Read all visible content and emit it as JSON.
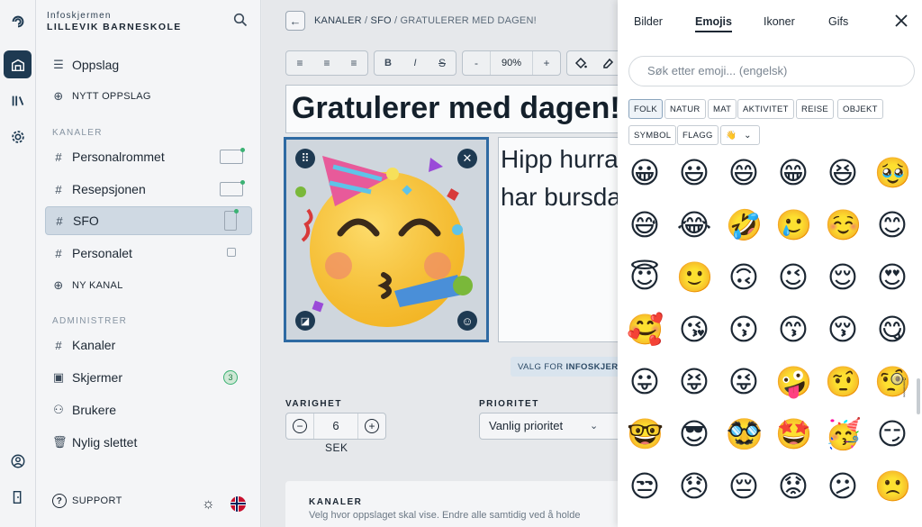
{
  "sidebar": {
    "brand_top": "Infoskjermen",
    "brand_name": "LILLEVIK BARNESKOLE",
    "oppslag": "Oppslag",
    "nytt_oppslag": "NYTT OPPSLAG",
    "kanaler_heading": "KANALER",
    "channels": [
      "Personalrommet",
      "Resepsjonen",
      "SFO",
      "Personalet"
    ],
    "ny_kanal": "NY KANAL",
    "administrer_heading": "ADMINISTRER",
    "admin": [
      "Kanaler",
      "Skjermer",
      "Brukere",
      "Nylig slettet"
    ],
    "skjermer_count": "3",
    "support": "SUPPORT"
  },
  "editor": {
    "crumb_1": "KANALER",
    "crumb_sep": " / ",
    "crumb_2": "SFO",
    "crumb_3": "GRATULERER MED DAGEN!",
    "zoom": "90%",
    "title": "Gratulerer med dagen!",
    "body_line_1": "Hipp hurra!",
    "body_line_2": "har bursdag!",
    "valg_prefix": "VALG FOR",
    "valg_target": "INFOSKJERMEN",
    "varighet_label": "VARIGHET",
    "varighet_value": "6",
    "varighet_unit": "SEK",
    "prioritet_label": "PRIORITET",
    "prioritet_value": "Vanlig prioritet",
    "kanaler_title": "KANALER",
    "kanaler_desc": "Velg hvor oppslaget skal vise. Endre alle samtidig ved å holde"
  },
  "picker": {
    "tabs": [
      "Bilder",
      "Emojis",
      "Ikoner",
      "Gifs"
    ],
    "active_tab": "Emojis",
    "search_placeholder": "Søk etter emoji... (engelsk)",
    "categories": [
      "FOLK",
      "NATUR",
      "MAT",
      "AKTIVITET",
      "REISE",
      "OBJEKT",
      "SYMBOL",
      "FLAGG"
    ],
    "skin_tone": "👋",
    "emojis": [
      [
        "😀",
        "😃",
        "😄",
        "😁",
        "😆",
        "🥹"
      ],
      [
        "😅",
        "😂",
        "🤣",
        "🥲",
        "☺️",
        "😊"
      ],
      [
        "😇",
        "🙂",
        "🙃",
        "😉",
        "😌",
        "😍"
      ],
      [
        "🥰",
        "😘",
        "😗",
        "😙",
        "😚",
        "😋"
      ],
      [
        "😛",
        "😝",
        "😜",
        "🤪",
        "🤨",
        "🧐"
      ],
      [
        "🤓",
        "😎",
        "🥸",
        "🤩",
        "🥳",
        "😏"
      ],
      [
        "😒",
        "😞",
        "😔",
        "😟",
        "😕",
        "🙁"
      ]
    ]
  },
  "colors": {
    "accent": "#2e6aa3",
    "nav_dark": "#1e3a52",
    "online": "#3bb273"
  }
}
